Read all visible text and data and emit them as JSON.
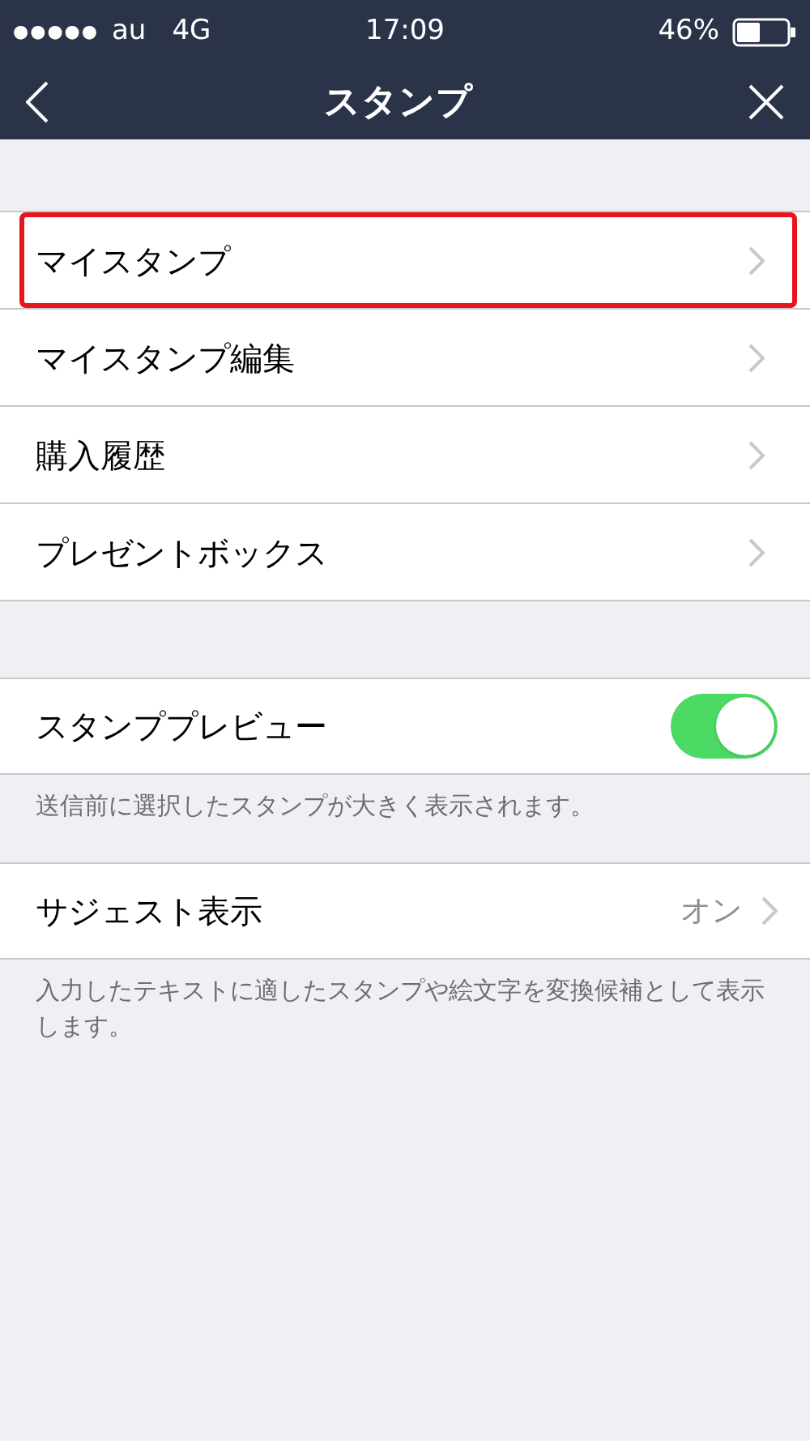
{
  "status_bar": {
    "signal_dots": "●●●●●",
    "carrier": "au",
    "network": "4G",
    "time": "17:09",
    "battery": "46%"
  },
  "nav": {
    "title": "スタンプ"
  },
  "menu_items": [
    {
      "label": "マイスタンプ",
      "highlighted": true
    },
    {
      "label": "マイスタンプ編集",
      "highlighted": false
    },
    {
      "label": "購入履歴",
      "highlighted": false
    },
    {
      "label": "プレゼントボックス",
      "highlighted": false
    }
  ],
  "preview": {
    "label": "スタンププレビュー",
    "on": true,
    "note": "送信前に選択したスタンプが大きく表示されます。"
  },
  "suggest": {
    "label": "サジェスト表示",
    "value": "オン",
    "note": "入力したテキストに適したスタンプや絵文字を変換候補として表示します。"
  }
}
